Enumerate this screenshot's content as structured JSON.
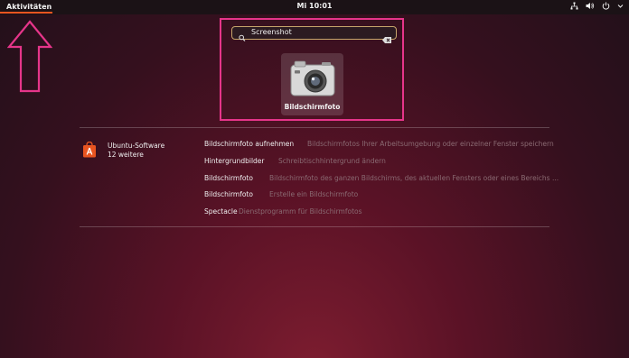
{
  "topbar": {
    "activities_label": "Aktivitäten",
    "clock": "Mi 10:01",
    "tray_icons": [
      "network-icon",
      "volume-icon",
      "power-icon",
      "chevron-down-icon"
    ]
  },
  "search": {
    "value": "Screenshot"
  },
  "app_tile": {
    "label": "Bildschirmfoto",
    "icon": "camera-icon"
  },
  "provider": {
    "name": "Ubuntu-Software",
    "more": "12 weitere",
    "icon": "software-bag-icon"
  },
  "results": [
    {
      "title": "Bildschirmfoto aufnehmen",
      "description": "Bildschirmfotos Ihrer Arbeitsumgebung oder einzelner Fenster speichern"
    },
    {
      "title": "Hintergrundbilder",
      "description": "Schreibtischhintergrund ändern"
    },
    {
      "title": "Bildschirmfoto",
      "description": "Bildschirmfoto des ganzen Bildschirms, des aktuellen Fensters oder eines Bereichs ..."
    },
    {
      "title": "Bildschirmfoto",
      "description": "Erstelle ein Bildschirmfoto"
    },
    {
      "title": "Spectacle",
      "description": "Dienstprogramm für Bildschirmfotos"
    }
  ],
  "colors": {
    "accent": "#e95420",
    "annotation": "#e6358a"
  }
}
